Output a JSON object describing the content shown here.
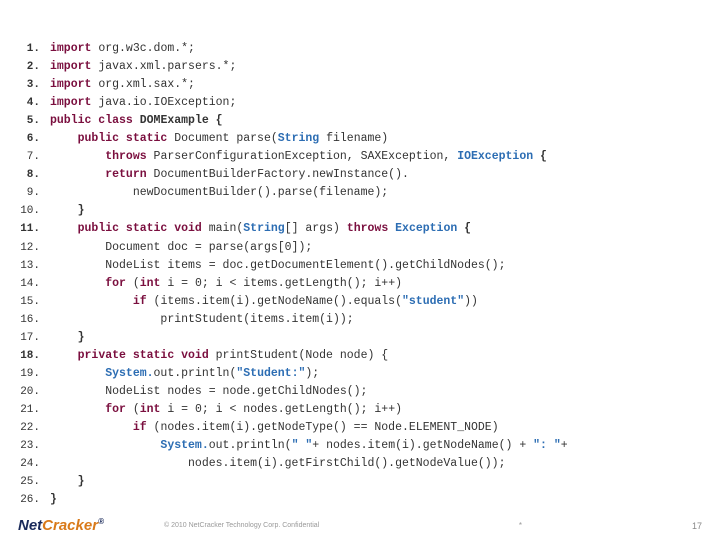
{
  "lines": [
    {
      "n": "1.",
      "bold": true,
      "indent": 0,
      "tokens": [
        [
          "kw",
          "import"
        ],
        [
          " "
        ],
        [
          "type",
          "org.w3c.dom.*;"
        ]
      ]
    },
    {
      "n": "2.",
      "bold": true,
      "indent": 0,
      "tokens": [
        [
          "kw",
          "import"
        ],
        [
          " "
        ],
        [
          "type",
          "javax.xml.parsers.*;"
        ]
      ]
    },
    {
      "n": "3.",
      "bold": true,
      "indent": 0,
      "tokens": [
        [
          "kw",
          "import"
        ],
        [
          " "
        ],
        [
          "type",
          "org.xml.sax.*;"
        ]
      ]
    },
    {
      "n": "4.",
      "bold": true,
      "indent": 0,
      "tokens": [
        [
          "kw",
          "import"
        ],
        [
          " "
        ],
        [
          "type",
          "java.io.IOException;"
        ]
      ]
    },
    {
      "n": "5.",
      "bold": true,
      "indent": 0,
      "tokens": [
        [
          "kw",
          "public class"
        ],
        [
          " "
        ],
        [
          "typeB",
          "DOMExample {"
        ]
      ]
    },
    {
      "n": "6.",
      "bold": true,
      "indent": 1,
      "tokens": [
        [
          "kw",
          "public static"
        ],
        [
          " "
        ],
        [
          "type",
          "Document parse("
        ],
        [
          "str",
          "String"
        ],
        [
          " "
        ],
        [
          "type",
          "filename)"
        ]
      ]
    },
    {
      "n": "7.",
      "bold": false,
      "indent": 2,
      "tokens": [
        [
          "kw",
          "throws"
        ],
        [
          " "
        ],
        [
          "type",
          "ParserConfigurationException, SAXException, "
        ],
        [
          "str",
          "IOException"
        ],
        [
          " "
        ],
        [
          "typeB",
          "{"
        ]
      ]
    },
    {
      "n": "8.",
      "bold": true,
      "indent": 2,
      "tokens": [
        [
          "kw",
          "return"
        ],
        [
          " "
        ],
        [
          "type",
          "DocumentBuilderFactory.newInstance()."
        ]
      ]
    },
    {
      "n": "9.",
      "bold": false,
      "indent": 3,
      "tokens": [
        [
          "type",
          "newDocumentBuilder().parse(filename);"
        ]
      ]
    },
    {
      "n": "10.",
      "bold": false,
      "indent": 1,
      "tokens": [
        [
          "typeB",
          "}"
        ]
      ]
    },
    {
      "n": "11.",
      "bold": true,
      "indent": 1,
      "tokens": [
        [
          "kw",
          "public static void"
        ],
        [
          " "
        ],
        [
          "type",
          "main("
        ],
        [
          "str",
          "String"
        ],
        [
          "type",
          "[] args) "
        ],
        [
          "kw",
          "throws"
        ],
        [
          " "
        ],
        [
          "str",
          "Exception"
        ],
        [
          " "
        ],
        [
          "typeB",
          "{"
        ]
      ]
    },
    {
      "n": "12.",
      "bold": false,
      "indent": 2,
      "tokens": [
        [
          "type",
          "Document doc = parse(args[0]);"
        ]
      ]
    },
    {
      "n": "13.",
      "bold": false,
      "indent": 2,
      "tokens": [
        [
          "type",
          "NodeList items = doc.getDocumentElement().getChildNodes();"
        ]
      ]
    },
    {
      "n": "14.",
      "bold": false,
      "indent": 2,
      "tokens": [
        [
          "kw",
          "for"
        ],
        [
          " "
        ],
        [
          "type",
          "("
        ],
        [
          "kw",
          "int"
        ],
        [
          " "
        ],
        [
          "type",
          "i = 0; i < items.getLength(); i++)"
        ]
      ]
    },
    {
      "n": "15.",
      "bold": false,
      "indent": 3,
      "tokens": [
        [
          "kw",
          "if"
        ],
        [
          " "
        ],
        [
          "type",
          "(items.item(i).getNodeName().equals("
        ],
        [
          "str",
          "\"student\""
        ],
        [
          "type",
          "))"
        ]
      ]
    },
    {
      "n": "16.",
      "bold": false,
      "indent": 4,
      "tokens": [
        [
          "type",
          "printStudent(items.item(i));"
        ]
      ]
    },
    {
      "n": "17.",
      "bold": false,
      "indent": 1,
      "tokens": [
        [
          "typeB",
          "}"
        ]
      ]
    },
    {
      "n": "18.",
      "bold": true,
      "indent": 1,
      "tokens": [
        [
          "kw",
          "private static void"
        ],
        [
          " "
        ],
        [
          "type",
          "printStudent(Node node) {"
        ]
      ]
    },
    {
      "n": "19.",
      "bold": false,
      "indent": 2,
      "tokens": [
        [
          "str",
          "System."
        ],
        [
          "type",
          "out.println("
        ],
        [
          "str",
          "\"Student:\""
        ],
        [
          "type",
          ");"
        ]
      ]
    },
    {
      "n": "20.",
      "bold": false,
      "indent": 2,
      "tokens": [
        [
          "type",
          "NodeList nodes = node.getChildNodes();"
        ]
      ]
    },
    {
      "n": "21.",
      "bold": false,
      "indent": 2,
      "tokens": [
        [
          "kw",
          "for"
        ],
        [
          " "
        ],
        [
          "type",
          "("
        ],
        [
          "kw",
          "int"
        ],
        [
          " "
        ],
        [
          "type",
          "i = 0; i < nodes.getLength(); i++)"
        ]
      ]
    },
    {
      "n": "22.",
      "bold": false,
      "indent": 3,
      "tokens": [
        [
          "kw",
          "if"
        ],
        [
          " "
        ],
        [
          "type",
          "(nodes.item(i).getNodeType() == Node.ELEMENT_NODE)"
        ]
      ]
    },
    {
      "n": "23.",
      "bold": false,
      "indent": 4,
      "tokens": [
        [
          "str",
          "System."
        ],
        [
          "type",
          "out.println("
        ],
        [
          "str",
          "\" \""
        ],
        [
          "type",
          "+ nodes.item(i).getNodeName() + "
        ],
        [
          "str",
          "\": \""
        ],
        [
          "type",
          "+"
        ]
      ]
    },
    {
      "n": "24.",
      "bold": false,
      "indent": 5,
      "tokens": [
        [
          "type",
          "nodes.item(i).getFirstChild().getNodeValue());"
        ]
      ]
    },
    {
      "n": "25.",
      "bold": false,
      "indent": 1,
      "tokens": [
        [
          "typeB",
          "}"
        ]
      ]
    },
    {
      "n": "26.",
      "bold": false,
      "indent": 0,
      "tokens": [
        [
          "typeB",
          "}"
        ]
      ]
    }
  ],
  "footer": {
    "logo1": "Net",
    "logo2": "Cracker",
    "reg": "®",
    "copyright": "© 2010 NetCracker Technology Corp. Confidential",
    "star": "*",
    "page": "17"
  }
}
